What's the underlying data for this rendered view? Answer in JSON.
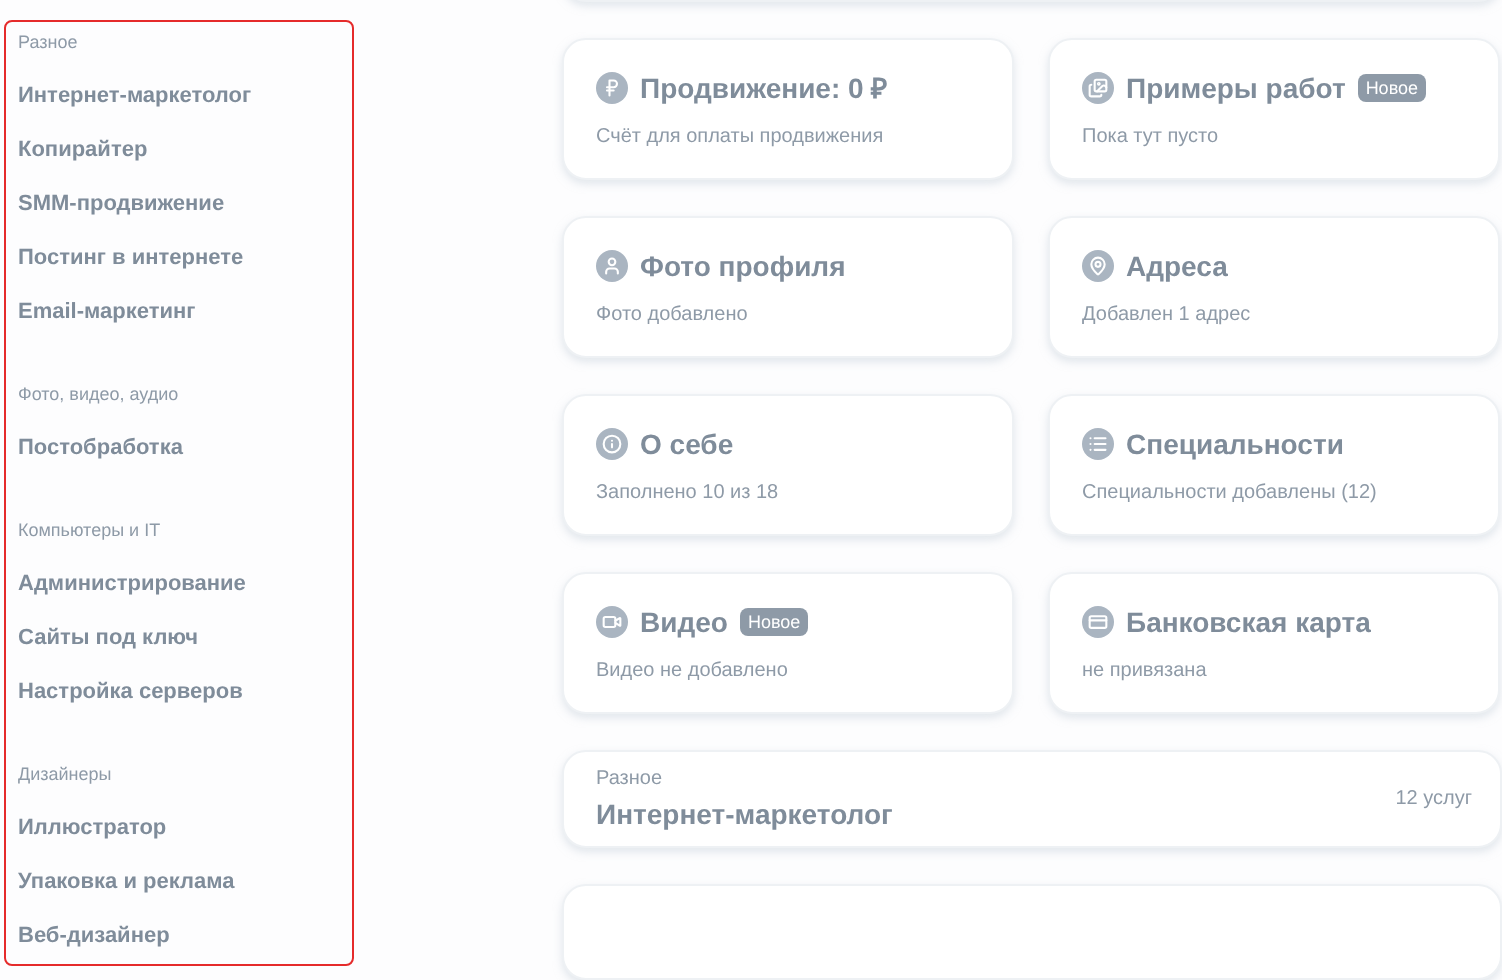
{
  "sidebar": {
    "groups": [
      {
        "heading": "Разное",
        "items": [
          "Интернет-маркетолог",
          "Копирайтер",
          "SMM-продвижение",
          "Постинг в интернете",
          "Email-маркетинг"
        ]
      },
      {
        "heading": "Фото, видео, аудио",
        "items": [
          "Постобработка"
        ]
      },
      {
        "heading": "Компьютеры и IT",
        "items": [
          "Администрирование",
          "Сайты под ключ",
          "Настройка серверов"
        ]
      },
      {
        "heading": "Дизайнеры",
        "items": [
          "Иллюстратор",
          "Упаковка и реклама",
          "Веб-дизайнер"
        ]
      }
    ]
  },
  "cards": [
    {
      "title": "Продвижение: 0 ₽",
      "subtitle": "Счёт для оплаты продвижения"
    },
    {
      "title": "Примеры работ",
      "badge": "Новое",
      "subtitle": "Пока тут пусто"
    },
    {
      "title": "Фото профиля",
      "subtitle": "Фото добавлено"
    },
    {
      "title": "Адреса",
      "subtitle": "Добавлен 1 адрес"
    },
    {
      "title": "О себе",
      "subtitle": "Заполнено 10 из 18"
    },
    {
      "title": "Специальности",
      "subtitle": "Специальности добавлены (12)"
    },
    {
      "title": "Видео",
      "badge": "Новое",
      "subtitle": "Видео не добавлено"
    },
    {
      "title": "Банковская карта",
      "subtitle": "не привязана"
    }
  ],
  "services": [
    {
      "category": "Разное",
      "title": "Интернет-маркетолог",
      "count": "12 услуг"
    }
  ]
}
